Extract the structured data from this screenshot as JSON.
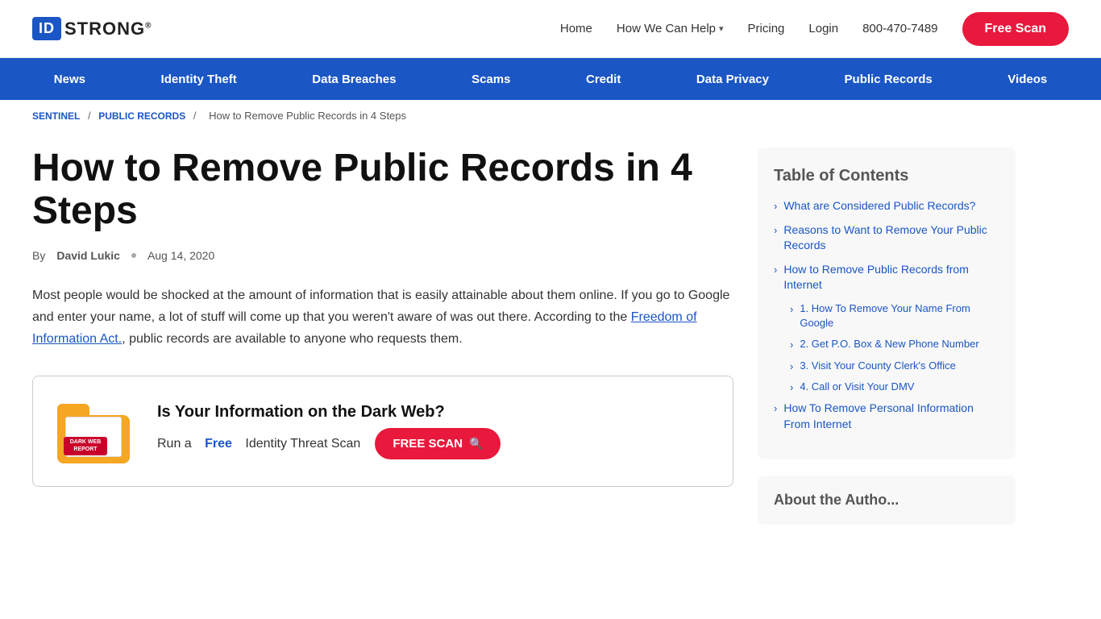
{
  "logo": {
    "id_text": "ID",
    "strong_text": "STRONG",
    "trademark": "®"
  },
  "header": {
    "nav": [
      {
        "label": "Home",
        "href": "#"
      },
      {
        "label": "How We Can Help",
        "href": "#",
        "has_dropdown": true
      },
      {
        "label": "Pricing",
        "href": "#"
      },
      {
        "label": "Login",
        "href": "#"
      }
    ],
    "phone": "800-470-7489",
    "free_scan_label": "Free Scan"
  },
  "blue_nav": {
    "items": [
      {
        "label": "News"
      },
      {
        "label": "Identity Theft"
      },
      {
        "label": "Data Breaches"
      },
      {
        "label": "Scams"
      },
      {
        "label": "Credit"
      },
      {
        "label": "Data Privacy"
      },
      {
        "label": "Public Records"
      },
      {
        "label": "Videos"
      }
    ]
  },
  "breadcrumb": {
    "sentinel": "SENTINEL",
    "public_records": "Public Records",
    "current": "How to Remove Public Records in 4 Steps"
  },
  "article": {
    "title": "How to Remove Public Records in 4 Steps",
    "by_label": "By",
    "author": "David Lukic",
    "date": "Aug 14, 2020",
    "body_1": "Most people would be shocked at the amount of information that is easily attainable about them online. If you go to Google and enter your name, a lot of stuff will come up that you weren't aware of was out there. According to the ",
    "link_text": "Freedom of Information Act.",
    "body_2": ", public records are available to anyone who requests them."
  },
  "dark_web_card": {
    "badge_line1": "DARK WEB",
    "badge_line2": "REPORT",
    "heading": "Is Your Information on the Dark Web?",
    "scan_text_before": "Run a",
    "free_word": "Free",
    "scan_text_after": "Identity Threat Scan",
    "button_label": "FREE SCAN"
  },
  "toc": {
    "title": "Table of Contents",
    "items": [
      {
        "label": "What are Considered Public Records?"
      },
      {
        "label": "Reasons to Want to Remove Your Public Records"
      },
      {
        "label": "How to Remove Public Records from Internet",
        "sub_items": [
          {
            "label": "1. How To Remove Your Name From Google"
          },
          {
            "label": "2. Get P.O. Box & New Phone Number"
          },
          {
            "label": "3. Visit Your County Clerk's Office"
          },
          {
            "label": "4. Call or Visit Your DMV"
          }
        ]
      },
      {
        "label": "How To Remove Personal Information From Internet"
      }
    ]
  },
  "about_author": {
    "title": "About the Autho..."
  },
  "colors": {
    "blue": "#1a56c4",
    "red": "#e8193c",
    "dark_text": "#111",
    "light_text": "#555"
  }
}
